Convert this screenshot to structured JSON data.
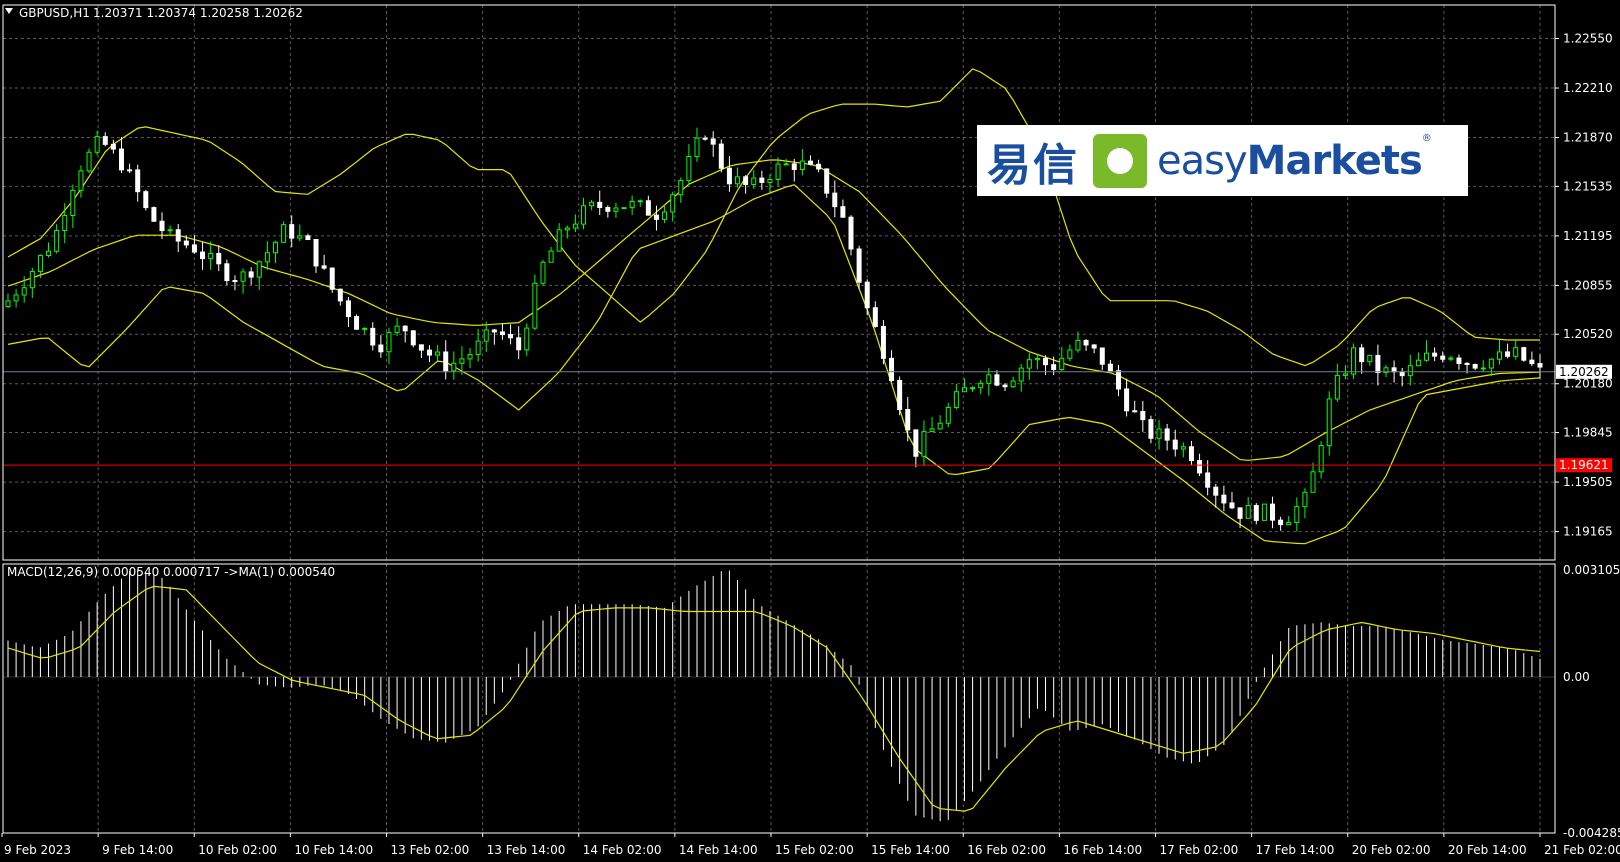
{
  "header": {
    "symbol_label": "GBPUSD,H1",
    "ohlc": "1.20371 1.20374 1.20258 1.20262"
  },
  "logo": {
    "cn": "易信",
    "en_light": "easy",
    "en_bold": "Markets",
    "reg": "®"
  },
  "colors": {
    "background": "#000000",
    "grid": "#5a5a5a",
    "candle_bull": "#00ff00",
    "candle_bear": "#ffffff",
    "bands": "#e6e600",
    "macd_hist": "#ffffff",
    "macd_signal": "#e6e600",
    "current_price_line": "#708090",
    "red_level": "#ff0000"
  },
  "chart_data": {
    "type": "candlestick",
    "price_axis_ticks": [
      "1.22550",
      "1.22210",
      "1.21870",
      "1.21535",
      "1.21195",
      "1.20855",
      "1.20520",
      "1.20180",
      "1.19845",
      "1.19505",
      "1.19165"
    ],
    "current_price": "1.20262",
    "red_level": "1.19621",
    "price_range": [
      1.1897,
      1.2278
    ],
    "time_labels": [
      "9 Feb 2023",
      "9 Feb 14:00",
      "10 Feb 02:00",
      "10 Feb 14:00",
      "13 Feb 02:00",
      "13 Feb 14:00",
      "14 Feb 02:00",
      "14 Feb 14:00",
      "15 Feb 02:00",
      "15 Feb 14:00",
      "16 Feb 02:00",
      "16 Feb 14:00",
      "17 Feb 02:00",
      "17 Feb 14:00",
      "20 Feb 02:00",
      "20 Feb 14:00",
      "21 Feb 02:00"
    ],
    "bars_per_label": 12,
    "close_path": [
      1.2075,
      1.2095,
      1.2118,
      1.2165,
      1.2185,
      1.2168,
      1.2135,
      1.2118,
      1.2112,
      1.2098,
      1.209,
      1.2105,
      1.2125,
      1.2112,
      1.2082,
      1.206,
      1.2045,
      1.2058,
      1.204,
      1.203,
      1.204,
      1.2055,
      1.2042,
      1.2098,
      1.2125,
      1.2138,
      1.2142,
      1.214,
      1.2135,
      1.2158,
      1.2192,
      1.216,
      1.2152,
      1.2165,
      1.217,
      1.216,
      1.213,
      1.207,
      1.203,
      1.197,
      1.199,
      1.201,
      1.2025,
      1.202,
      1.2035,
      1.203,
      1.2045,
      1.2038,
      1.201,
      1.1985,
      1.198,
      1.197,
      1.1945,
      1.193,
      1.193,
      1.1925,
      1.194,
      1.201,
      1.204,
      1.2028,
      1.2022,
      1.2035,
      1.204,
      1.2032,
      1.2035,
      1.2038,
      1.2026
    ],
    "bands_upper_path": [
      1.2105,
      1.2118,
      1.2145,
      1.218,
      1.2195,
      1.219,
      1.2185,
      1.217,
      1.215,
      1.2148,
      1.2162,
      1.218,
      1.219,
      1.2185,
      1.2165,
      1.2165,
      1.213,
      1.21,
      1.208,
      1.206,
      1.208,
      1.211,
      1.2155,
      1.2185,
      1.2203,
      1.221,
      1.221,
      1.2208,
      1.2212,
      1.2235,
      1.222,
      1.218,
      1.211,
      1.2075,
      1.2075,
      1.2075,
      1.2068,
      1.2055,
      1.2038,
      1.203,
      1.2045,
      1.207,
      1.2078,
      1.2068,
      1.205,
      1.2048,
      1.2048
    ],
    "bands_mid_path": [
      1.2085,
      1.2095,
      1.211,
      1.212,
      1.212,
      1.2112,
      1.2098,
      1.209,
      1.208,
      1.2066,
      1.206,
      1.2058,
      1.206,
      1.208,
      1.2105,
      1.213,
      1.2155,
      1.2168,
      1.2172,
      1.2168,
      1.215,
      1.212,
      1.2085,
      1.2055,
      1.204,
      1.203,
      1.2025,
      1.201,
      1.1985,
      1.1965,
      1.1968,
      1.1985,
      1.2,
      1.201,
      1.202,
      1.2025,
      1.2026
    ],
    "bands_lower_path": [
      1.2045,
      1.205,
      1.2028,
      1.2055,
      1.2085,
      1.208,
      1.206,
      1.2045,
      1.203,
      1.2025,
      1.2012,
      1.2035,
      1.202,
      1.2,
      1.2025,
      1.206,
      1.211,
      1.212,
      1.213,
      1.2145,
      1.2155,
      1.213,
      1.206,
      1.1975,
      1.1955,
      1.196,
      1.199,
      1.1995,
      1.199,
      1.197,
      1.195,
      1.1928,
      1.191,
      1.1908,
      1.1918,
      1.195,
      1.201,
      1.2015,
      1.202,
      1.2022
    ],
    "macd": {
      "label": "MACD(12,26,9) 0.000540 0.000717  ->MA(1) 0.000540",
      "axis_ticks": [
        "0.003105",
        "0.00",
        "-0.004285"
      ],
      "range": [
        -0.004285,
        0.003105
      ],
      "hist_path": [
        0.001,
        0.0008,
        0.0012,
        0.0022,
        0.003,
        0.0027,
        0.0015,
        0.0005,
        -0.0002,
        -0.0003,
        -0.0002,
        -0.0005,
        -0.0012,
        -0.0017,
        -0.0018,
        -0.0014,
        -0.0002,
        0.0015,
        0.002,
        0.002,
        0.002,
        0.0019,
        0.0025,
        0.003,
        0.002,
        0.0015,
        0.001,
        0.0003,
        -0.002,
        -0.0038,
        -0.004,
        -0.003,
        -0.0018,
        -0.0008,
        -0.0015,
        -0.0013,
        -0.0017,
        -0.0022,
        -0.0024,
        -0.0018,
        0.0,
        0.0014,
        0.0015,
        0.0014,
        0.0014,
        0.0012,
        0.001,
        0.0009,
        0.0008,
        0.0005
      ],
      "signal_path": [
        0.0008,
        0.0005,
        0.0008,
        0.0018,
        0.0025,
        0.0024,
        0.0014,
        0.0004,
        -0.0001,
        -0.0003,
        -0.0005,
        -0.0012,
        -0.0017,
        -0.0016,
        -0.0008,
        0.0007,
        0.0018,
        0.0019,
        0.0019,
        0.0018,
        0.0018,
        0.0018,
        0.0014,
        0.0008,
        -0.0006,
        -0.0022,
        -0.0036,
        -0.0037,
        -0.0025,
        -0.0015,
        -0.0012,
        -0.0015,
        -0.0018,
        -0.0021,
        -0.0019,
        -0.0008,
        0.0008,
        0.0013,
        0.0015,
        0.0013,
        0.0012,
        0.001,
        0.0008,
        0.0007
      ]
    }
  }
}
